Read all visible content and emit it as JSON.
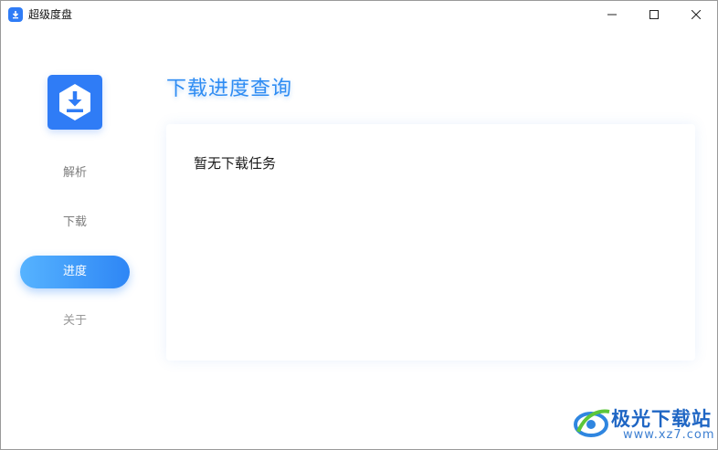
{
  "window": {
    "title": "超级度盘"
  },
  "icons": {
    "app": "download-shield-icon",
    "minimize": "minimize-icon",
    "maximize": "maximize-icon",
    "close": "close-icon",
    "logo": "download-hexagon-icon"
  },
  "sidebar": {
    "items": [
      {
        "label": "解析",
        "active": false
      },
      {
        "label": "下载",
        "active": false
      },
      {
        "label": "进度",
        "active": true
      },
      {
        "label": "关于",
        "active": false
      }
    ]
  },
  "main": {
    "title": "下载进度查询",
    "empty_message": "暂无下载任务"
  },
  "watermark": {
    "title": "极光下载站",
    "url": "www.xz7.com"
  },
  "colors": {
    "accent": "#2e86f5",
    "accent_light": "#56b3ff",
    "title_blue": "#2e8cf3",
    "inactive_text": "#7d7d7d"
  }
}
